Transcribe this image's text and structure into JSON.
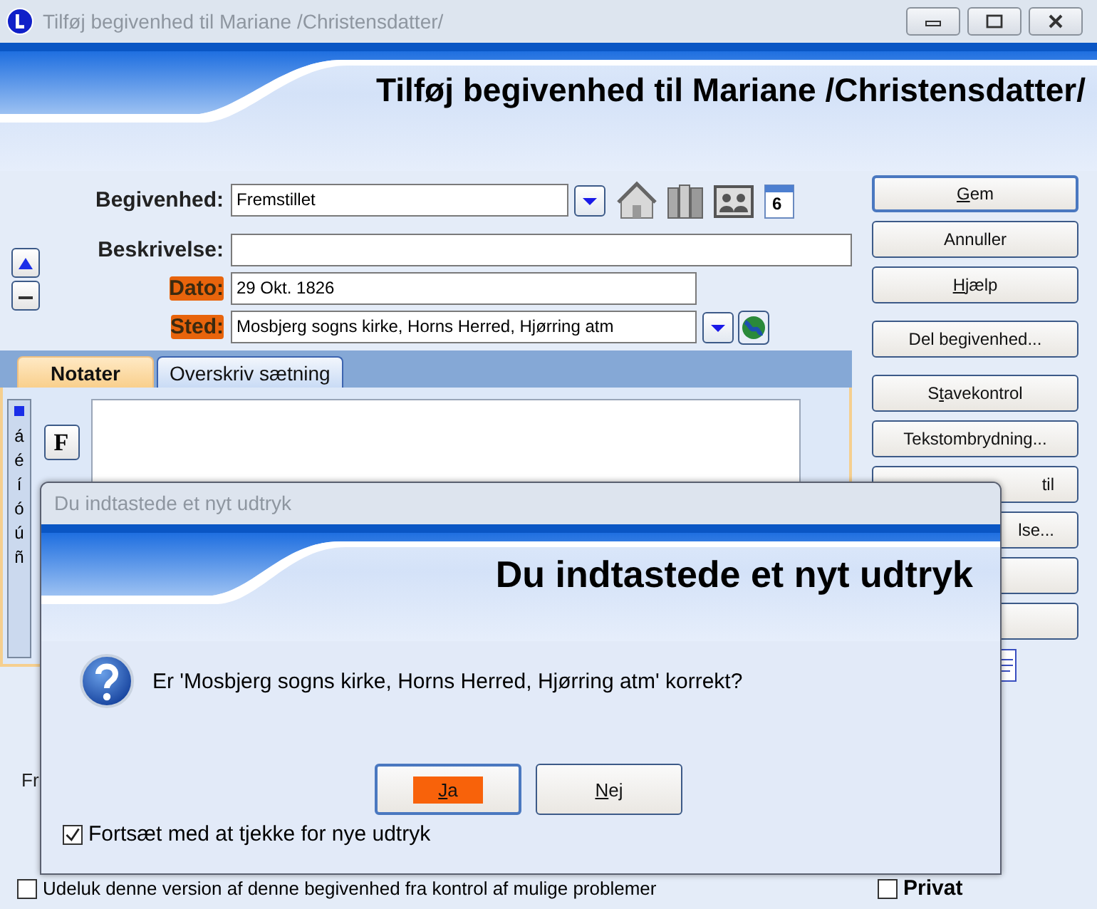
{
  "window": {
    "title": "Tilføj begivenhed til Mariane /Christensdatter/",
    "heading": "Tilføj begivenhed til Mariane /Christensdatter/"
  },
  "fields": [
    {
      "kind": "combo",
      "label": "Begivenhed:",
      "value": "Fremstillet",
      "highlighted": false
    },
    {
      "kind": "wide",
      "label": "Beskrivelse:",
      "highlighted": false
    },
    {
      "kind": "plain",
      "label": "Dato:",
      "value": "29 Okt. 1826",
      "highlighted": true
    },
    {
      "kind": "place",
      "label": "Sted:",
      "value": "Mosbjerg sogns kirke, Horns Herred, Hjørring atm",
      "highlighted": true
    }
  ],
  "calendar_day": "6",
  "side_buttons": [
    {
      "kind": "full",
      "key": "G",
      "post": "em",
      "group_start": false,
      "focused": true
    },
    {
      "kind": "full",
      "pre": "Annuller",
      "group_start": false,
      "focused": false
    },
    {
      "kind": "full",
      "key": "H",
      "post": "jælp",
      "group_start": false,
      "focused": false
    },
    {
      "kind": "full",
      "pre": "Del begivenhed...",
      "group_start": true,
      "focused": false
    },
    {
      "kind": "full",
      "pre": "S",
      "key": "t",
      "post": "avekontrol",
      "group_start": true,
      "focused": false
    },
    {
      "kind": "full",
      "pre": "Tekstombrydning...",
      "group_start": false,
      "focused": false
    },
    {
      "kind": "partial",
      "pre": "til",
      "group_start": false,
      "focused": false
    },
    {
      "kind": "partial",
      "pre": "lse...",
      "group_start": false,
      "focused": false
    },
    {
      "kind": "blank",
      "group_start": false,
      "focused": false
    },
    {
      "kind": "blank",
      "group_start": false,
      "focused": false
    }
  ],
  "tabs": [
    {
      "label": "Notater",
      "selected": true
    },
    {
      "label": "Overskriv sætning",
      "selected": false
    }
  ],
  "special_chars": [
    "á",
    "é",
    "í",
    "ó",
    "ú",
    "ñ"
  ],
  "format_button": "F",
  "footer_label": "Fr",
  "exclude_check": {
    "label": "Udeluk denne version af denne begivenhed fra kontrol af mulige problemer",
    "checked": false
  },
  "private_check": {
    "label": "Privat",
    "checked": false
  },
  "dialog": {
    "title": "Du indtastede et nyt udtryk",
    "heading": "Du indtastede et nyt udtryk",
    "message": "Er 'Mosbjerg sogns kirke, Horns Herred, Hjørring atm' korrekt?",
    "buttons": [
      {
        "key": "J",
        "post": "a",
        "focused": true,
        "highlighted": true
      },
      {
        "key": "N",
        "post": "ej",
        "focused": false,
        "highlighted": false
      }
    ],
    "checkbox": {
      "label": "Fortsæt med at tjekke for nye udtryk",
      "checked": true
    }
  }
}
